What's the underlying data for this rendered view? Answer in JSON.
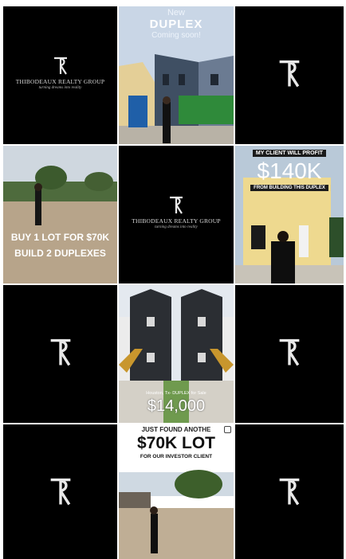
{
  "logo": {
    "monogram": "TR",
    "company_name": "THIBODEAUX REALTY GROUP",
    "tagline": "turning dreams into reality"
  },
  "posts": {
    "duplex_coming": {
      "line1": "New",
      "line2": "DUPLEX",
      "line3": "Coming soon!"
    },
    "lot_70k": {
      "line1": "BUY 1 LOT FOR $70K",
      "line2": "BUILD 2 DUPLEXES"
    },
    "profit": {
      "banner": "MY CLIENT WILL PROFIT",
      "amount": "$140K",
      "caption": "FROM BUILDING THIS DUPLEX"
    },
    "for_sale": {
      "banner": "Houston, Tx- DUPLEX for Sale",
      "price": "$14,000"
    },
    "another_lot": {
      "line1": "JUST FOUND ANOTHE",
      "amount": "$70K LOT",
      "line3": "FOR OUR INVESTOR CLIENT"
    }
  },
  "colors": {
    "background": "#000000",
    "accent_green": "#2e9e3a",
    "sky": "#c9d6e6"
  }
}
